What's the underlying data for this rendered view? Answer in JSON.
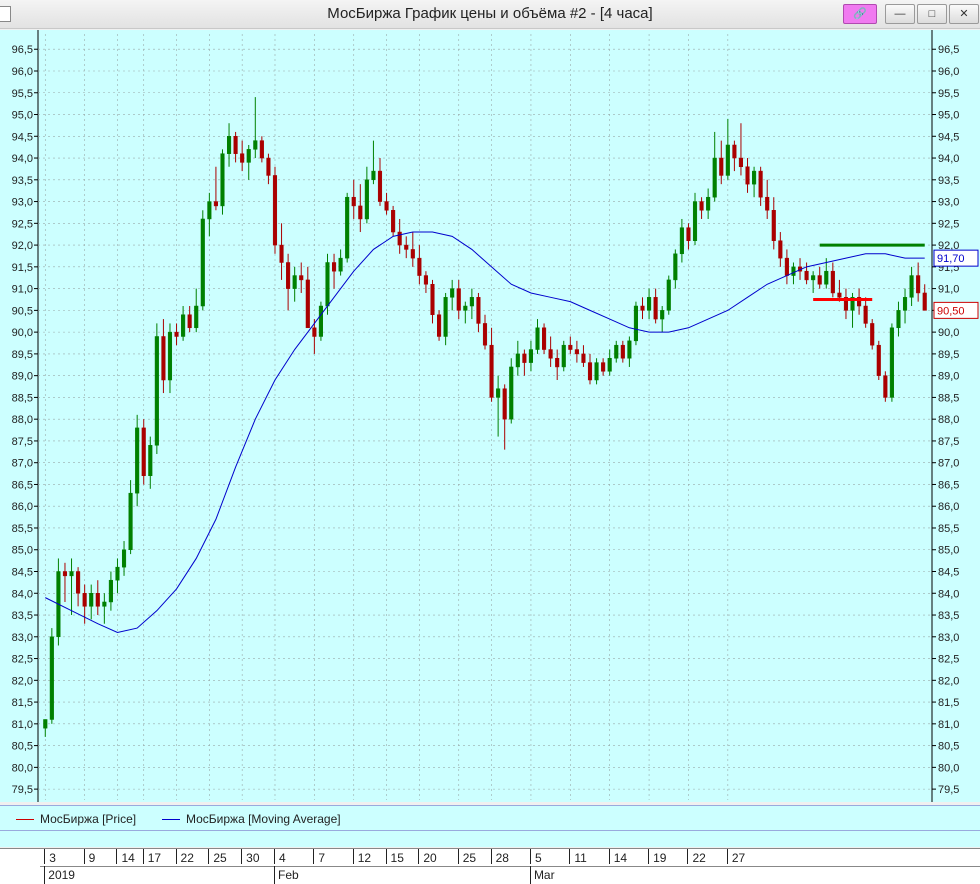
{
  "window": {
    "title": "МосБиржа График цены и объёма #2 - [4 часа]",
    "buttons": {
      "minimize": "—",
      "restore": "□",
      "close": "✕"
    }
  },
  "chart_data": {
    "type": "candlestick",
    "timeframe": "4 часа",
    "y_axis": {
      "min": 79.25,
      "max": 96.85,
      "ticks": [
        "96,5",
        "96,0",
        "95,5",
        "95,0",
        "94,5",
        "94,0",
        "93,5",
        "93,0",
        "92,5",
        "92,0",
        "91,5",
        "91,0",
        "90,5",
        "90,0",
        "89,5",
        "89,0",
        "88,5",
        "88,0",
        "87,5",
        "87,0",
        "86,5",
        "86,0",
        "85,5",
        "85,0",
        "84,5",
        "84,0",
        "83,5",
        "83,0",
        "82,5",
        "82,0",
        "81,5",
        "81,0",
        "80,5",
        "80,0",
        "79,5"
      ]
    },
    "x_axis": {
      "day_ticks": [
        "3",
        "9",
        "14",
        "17",
        "22",
        "25",
        "30",
        "4",
        "7",
        "12",
        "15",
        "20",
        "25",
        "28",
        "5",
        "11",
        "14",
        "19",
        "22",
        "27"
      ],
      "month_labels": [
        "2019",
        "Feb",
        "Mar"
      ]
    },
    "series": [
      {
        "name": "МосБиржа [Price]",
        "color": "#cc0000",
        "up_color": "#008000",
        "down_color": "#aa0000"
      },
      {
        "name": "МосБиржа [Moving Average]",
        "color": "#0000cc"
      }
    ],
    "candles": [
      [
        80.9,
        81.1,
        80.7,
        81.1
      ],
      [
        81.1,
        83.2,
        81.0,
        83.0
      ],
      [
        83.0,
        84.8,
        82.8,
        84.5
      ],
      [
        84.5,
        84.7,
        83.8,
        84.4
      ],
      [
        84.4,
        84.8,
        83.5,
        84.5
      ],
      [
        84.5,
        84.6,
        83.7,
        84.0
      ],
      [
        84.0,
        84.2,
        83.3,
        83.7
      ],
      [
        83.7,
        84.2,
        83.4,
        84.0
      ],
      [
        84.0,
        84.3,
        83.5,
        83.7
      ],
      [
        83.7,
        84.0,
        83.3,
        83.8
      ],
      [
        83.8,
        84.5,
        83.6,
        84.3
      ],
      [
        84.3,
        84.8,
        84.0,
        84.6
      ],
      [
        84.6,
        85.2,
        84.4,
        85.0
      ],
      [
        85.0,
        86.6,
        84.9,
        86.3
      ],
      [
        86.3,
        88.1,
        86.0,
        87.8
      ],
      [
        87.8,
        88.0,
        86.5,
        86.7
      ],
      [
        86.7,
        87.6,
        86.4,
        87.4
      ],
      [
        87.4,
        90.2,
        87.2,
        89.9
      ],
      [
        89.9,
        90.3,
        88.6,
        88.9
      ],
      [
        88.9,
        90.2,
        88.6,
        90.0
      ],
      [
        90.0,
        90.2,
        89.7,
        89.9
      ],
      [
        89.9,
        90.6,
        89.8,
        90.4
      ],
      [
        90.4,
        90.6,
        90.0,
        90.1
      ],
      [
        90.1,
        91.0,
        90.0,
        90.6
      ],
      [
        90.6,
        92.8,
        90.5,
        92.6
      ],
      [
        92.6,
        93.2,
        92.2,
        93.0
      ],
      [
        93.0,
        93.8,
        92.8,
        92.9
      ],
      [
        92.9,
        94.2,
        92.7,
        94.1
      ],
      [
        94.1,
        94.8,
        93.8,
        94.5
      ],
      [
        94.5,
        94.6,
        93.9,
        94.1
      ],
      [
        94.1,
        94.4,
        93.7,
        93.9
      ],
      [
        93.9,
        94.3,
        93.5,
        94.2
      ],
      [
        94.2,
        95.4,
        94.0,
        94.4
      ],
      [
        94.4,
        94.5,
        93.9,
        94.0
      ],
      [
        94.0,
        94.1,
        93.4,
        93.6
      ],
      [
        93.6,
        93.8,
        91.8,
        92.0
      ],
      [
        92.0,
        92.5,
        91.2,
        91.6
      ],
      [
        91.6,
        91.8,
        90.5,
        91.0
      ],
      [
        91.0,
        91.5,
        90.7,
        91.3
      ],
      [
        91.3,
        91.6,
        90.9,
        91.2
      ],
      [
        91.2,
        91.5,
        90.1,
        90.1
      ],
      [
        90.1,
        90.3,
        89.5,
        89.9
      ],
      [
        89.9,
        90.7,
        89.8,
        90.6
      ],
      [
        90.6,
        91.8,
        90.4,
        91.6
      ],
      [
        91.6,
        91.8,
        91.0,
        91.4
      ],
      [
        91.4,
        91.9,
        91.3,
        91.7
      ],
      [
        91.7,
        93.2,
        91.6,
        93.1
      ],
      [
        93.1,
        93.5,
        92.6,
        92.9
      ],
      [
        92.9,
        93.4,
        92.3,
        92.6
      ],
      [
        92.6,
        93.8,
        92.5,
        93.5
      ],
      [
        93.5,
        94.4,
        93.4,
        93.7
      ],
      [
        93.7,
        94.0,
        92.9,
        93.0
      ],
      [
        93.0,
        93.2,
        92.7,
        92.8
      ],
      [
        92.8,
        92.9,
        92.2,
        92.3
      ],
      [
        92.3,
        92.6,
        91.8,
        92.0
      ],
      [
        92.0,
        92.2,
        91.7,
        91.9
      ],
      [
        91.9,
        92.3,
        91.5,
        91.7
      ],
      [
        91.7,
        92.0,
        91.1,
        91.3
      ],
      [
        91.3,
        91.4,
        90.9,
        91.1
      ],
      [
        91.1,
        91.2,
        90.2,
        90.4
      ],
      [
        90.4,
        90.5,
        89.8,
        89.9
      ],
      [
        89.9,
        90.9,
        89.7,
        90.8
      ],
      [
        90.8,
        91.2,
        90.5,
        91.0
      ],
      [
        91.0,
        91.2,
        90.3,
        90.5
      ],
      [
        90.5,
        90.7,
        90.2,
        90.6
      ],
      [
        90.6,
        91.0,
        90.3,
        90.8
      ],
      [
        90.8,
        90.9,
        90.0,
        90.2
      ],
      [
        90.2,
        90.4,
        89.6,
        89.7
      ],
      [
        89.7,
        90.1,
        88.4,
        88.5
      ],
      [
        88.5,
        89.0,
        87.6,
        88.7
      ],
      [
        88.7,
        88.8,
        87.3,
        88.0
      ],
      [
        88.0,
        89.4,
        87.9,
        89.2
      ],
      [
        89.2,
        89.8,
        89.0,
        89.5
      ],
      [
        89.5,
        89.6,
        89.0,
        89.3
      ],
      [
        89.3,
        89.8,
        89.1,
        89.6
      ],
      [
        89.6,
        90.3,
        89.5,
        90.1
      ],
      [
        90.1,
        90.2,
        89.5,
        89.6
      ],
      [
        89.6,
        89.9,
        89.2,
        89.4
      ],
      [
        89.4,
        89.6,
        88.9,
        89.2
      ],
      [
        89.2,
        89.8,
        89.1,
        89.7
      ],
      [
        89.7,
        89.9,
        89.5,
        89.6
      ],
      [
        89.6,
        89.8,
        89.3,
        89.5
      ],
      [
        89.5,
        89.7,
        89.2,
        89.3
      ],
      [
        89.3,
        89.5,
        88.8,
        88.9
      ],
      [
        88.9,
        89.4,
        88.8,
        89.3
      ],
      [
        89.3,
        89.4,
        89.0,
        89.1
      ],
      [
        89.1,
        89.6,
        89.0,
        89.4
      ],
      [
        89.4,
        89.8,
        89.3,
        89.7
      ],
      [
        89.7,
        89.8,
        89.3,
        89.4
      ],
      [
        89.4,
        89.9,
        89.2,
        89.8
      ],
      [
        89.8,
        90.7,
        89.7,
        90.6
      ],
      [
        90.6,
        90.8,
        90.3,
        90.5
      ],
      [
        90.5,
        91.0,
        90.3,
        90.8
      ],
      [
        90.8,
        91.0,
        90.2,
        90.3
      ],
      [
        90.3,
        90.6,
        90.0,
        90.5
      ],
      [
        90.5,
        91.3,
        90.4,
        91.2
      ],
      [
        91.2,
        91.9,
        91.0,
        91.8
      ],
      [
        91.8,
        92.6,
        91.6,
        92.4
      ],
      [
        92.4,
        92.5,
        91.9,
        92.1
      ],
      [
        92.1,
        93.2,
        92.0,
        93.0
      ],
      [
        93.0,
        93.1,
        92.6,
        92.8
      ],
      [
        92.8,
        93.3,
        92.6,
        93.1
      ],
      [
        93.1,
        94.6,
        93.0,
        94.0
      ],
      [
        94.0,
        94.4,
        93.4,
        93.6
      ],
      [
        93.6,
        94.9,
        93.5,
        94.3
      ],
      [
        94.3,
        94.4,
        93.7,
        94.0
      ],
      [
        94.0,
        94.8,
        93.6,
        93.8
      ],
      [
        93.8,
        94.0,
        93.2,
        93.4
      ],
      [
        93.4,
        93.8,
        93.1,
        93.7
      ],
      [
        93.7,
        93.8,
        92.9,
        93.1
      ],
      [
        93.1,
        93.5,
        92.6,
        92.8
      ],
      [
        92.8,
        93.1,
        91.9,
        92.1
      ],
      [
        92.1,
        92.3,
        91.5,
        91.7
      ],
      [
        91.7,
        91.9,
        91.1,
        91.3
      ],
      [
        91.3,
        91.6,
        91.1,
        91.5
      ],
      [
        91.5,
        91.7,
        91.2,
        91.4
      ],
      [
        91.4,
        91.6,
        91.1,
        91.2
      ],
      [
        91.2,
        91.4,
        90.9,
        91.3
      ],
      [
        91.3,
        91.5,
        91.0,
        91.1
      ],
      [
        91.1,
        91.7,
        91.0,
        91.4
      ],
      [
        91.4,
        91.6,
        90.8,
        90.9
      ],
      [
        90.9,
        91.2,
        90.7,
        90.8
      ],
      [
        90.8,
        91.0,
        90.3,
        90.5
      ],
      [
        90.5,
        90.9,
        90.1,
        90.8
      ],
      [
        90.8,
        91.0,
        90.4,
        90.6
      ],
      [
        90.6,
        90.8,
        90.1,
        90.2
      ],
      [
        90.2,
        90.3,
        89.6,
        89.7
      ],
      [
        89.7,
        89.8,
        88.9,
        89.0
      ],
      [
        89.0,
        89.1,
        88.4,
        88.5
      ],
      [
        88.5,
        90.2,
        88.4,
        90.1
      ],
      [
        90.1,
        90.7,
        89.9,
        90.5
      ],
      [
        90.5,
        91.0,
        90.2,
        90.8
      ],
      [
        90.8,
        91.5,
        90.6,
        91.3
      ],
      [
        91.3,
        91.6,
        90.7,
        90.9
      ],
      [
        90.9,
        91.1,
        90.5,
        90.5
      ]
    ],
    "moving_average": [
      [
        0,
        83.9
      ],
      [
        4,
        83.6
      ],
      [
        8,
        83.3
      ],
      [
        11,
        83.1
      ],
      [
        14,
        83.2
      ],
      [
        17,
        83.6
      ],
      [
        20,
        84.1
      ],
      [
        23,
        84.8
      ],
      [
        26,
        85.7
      ],
      [
        29,
        86.9
      ],
      [
        32,
        88.0
      ],
      [
        35,
        88.9
      ],
      [
        38,
        89.6
      ],
      [
        41,
        90.2
      ],
      [
        44,
        90.8
      ],
      [
        47,
        91.4
      ],
      [
        50,
        91.9
      ],
      [
        53,
        92.2
      ],
      [
        56,
        92.3
      ],
      [
        59,
        92.3
      ],
      [
        62,
        92.2
      ],
      [
        65,
        91.9
      ],
      [
        68,
        91.5
      ],
      [
        71,
        91.1
      ],
      [
        74,
        90.9
      ],
      [
        77,
        90.8
      ],
      [
        80,
        90.7
      ],
      [
        83,
        90.5
      ],
      [
        86,
        90.3
      ],
      [
        89,
        90.1
      ],
      [
        92,
        90.0
      ],
      [
        95,
        90.0
      ],
      [
        98,
        90.1
      ],
      [
        101,
        90.3
      ],
      [
        104,
        90.5
      ],
      [
        107,
        90.8
      ],
      [
        110,
        91.1
      ],
      [
        113,
        91.3
      ],
      [
        116,
        91.5
      ],
      [
        119,
        91.6
      ],
      [
        122,
        91.7
      ],
      [
        125,
        91.8
      ],
      [
        128,
        91.8
      ],
      [
        131,
        91.7
      ],
      [
        134,
        91.7
      ]
    ],
    "levels": [
      {
        "color": "#008000",
        "value": 92.0,
        "from_candle": 118,
        "to_candle": 134
      },
      {
        "color": "#ff0000",
        "value": 90.75,
        "from_candle": 117,
        "to_candle": 126
      }
    ],
    "current_labels": [
      {
        "text": "91,70",
        "color": "#0000cc",
        "value": 91.7
      },
      {
        "text": "90,50",
        "color": "#cc0000",
        "value": 90.5
      }
    ],
    "grid": true
  }
}
